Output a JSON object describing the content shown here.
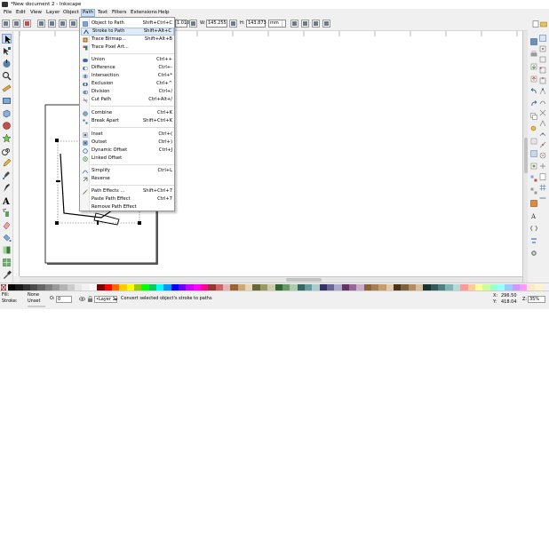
{
  "window": {
    "title": "*New document 2 - Inkscape"
  },
  "menubar": {
    "items": [
      "File",
      "Edit",
      "View",
      "Layer",
      "Object",
      "Path",
      "Text",
      "Filters",
      "Extensions",
      "Help"
    ],
    "active": "Path"
  },
  "controls": {
    "x_value": "1.010",
    "w_label": "W:",
    "w_value": "145.255",
    "h_label": "H:",
    "h_value": "143.873",
    "unit": "mm"
  },
  "path_menu": {
    "items": [
      {
        "label": "Object to Path",
        "shortcut": "Shift+Ctrl+C",
        "icon": "object-to-path-icon"
      },
      {
        "label": "Stroke to Path",
        "shortcut": "Shift+Alt+C",
        "icon": "stroke-to-path-icon",
        "highlighted": true
      },
      {
        "label": "Trace Bitmap...",
        "shortcut": "Shift+Alt+B",
        "icon": "trace-bitmap-icon"
      },
      {
        "label": "Trace Pixel Art...",
        "shortcut": "",
        "icon": "trace-pixel-art-icon"
      },
      {
        "label": "Union",
        "shortcut": "Ctrl++",
        "icon": "union-icon"
      },
      {
        "label": "Difference",
        "shortcut": "Ctrl+-",
        "icon": "difference-icon"
      },
      {
        "label": "Intersection",
        "shortcut": "Ctrl+*",
        "icon": "intersection-icon"
      },
      {
        "label": "Exclusion",
        "shortcut": "Ctrl+^",
        "icon": "exclusion-icon"
      },
      {
        "label": "Division",
        "shortcut": "Ctrl+/",
        "icon": "division-icon"
      },
      {
        "label": "Cut Path",
        "shortcut": "Ctrl+Alt+/",
        "icon": "cut-path-icon"
      },
      {
        "label": "Combine",
        "shortcut": "Ctrl+K",
        "icon": "combine-icon"
      },
      {
        "label": "Break Apart",
        "shortcut": "Shift+Ctrl+K",
        "icon": "break-apart-icon"
      },
      {
        "label": "Inset",
        "shortcut": "Ctrl+(",
        "icon": "inset-icon"
      },
      {
        "label": "Outset",
        "shortcut": "Ctrl+)",
        "icon": "outset-icon"
      },
      {
        "label": "Dynamic Offset",
        "shortcut": "Ctrl+J",
        "icon": "dynamic-offset-icon"
      },
      {
        "label": "Linked Offset",
        "shortcut": "",
        "icon": "linked-offset-icon"
      },
      {
        "label": "Simplify",
        "shortcut": "Ctrl+L",
        "icon": "simplify-icon"
      },
      {
        "label": "Reverse",
        "shortcut": "",
        "icon": "reverse-icon"
      },
      {
        "label": "Path Effects ...",
        "shortcut": "Shift+Ctrl+7",
        "icon": "path-effects-icon"
      },
      {
        "label": "Paste Path Effect",
        "shortcut": "Ctrl+7",
        "icon": ""
      },
      {
        "label": "Remove Path Effect",
        "shortcut": "",
        "icon": ""
      }
    ]
  },
  "status": {
    "fill_label": "Fill:",
    "fill_value": "None",
    "stroke_label": "Stroke:",
    "stroke_value": "Unset",
    "opacity_label": "O:",
    "opacity_value": "0",
    "layer": "•Layer 1",
    "message": "Convert selected object's stroke to paths",
    "x_label": "X:",
    "x_value": "296.50",
    "y_label": "Y:",
    "y_value": "418.04",
    "zoom_label": "Z:",
    "zoom_value": "35%"
  },
  "colors": {
    "menu_highlight": "#dfeaf7",
    "palette": [
      "#000000",
      "#1a1a1a",
      "#333333",
      "#4d4d4d",
      "#666666",
      "#808080",
      "#999999",
      "#b3b3b3",
      "#cccccc",
      "#e6e6e6",
      "#f2f2f2",
      "#ffffff",
      "#800000",
      "#ff0000",
      "#ff6600",
      "#ffcc00",
      "#ffff00",
      "#99cc00",
      "#00ff00",
      "#00cc66",
      "#00ffff",
      "#0099ff",
      "#0000ff",
      "#6600ff",
      "#cc00ff",
      "#ff00ff",
      "#ff0099",
      "#993333",
      "#cc6666",
      "#e6b3b3",
      "#996633",
      "#ccaa77",
      "#e6d5b3",
      "#666633",
      "#999966",
      "#ccccaa",
      "#336633",
      "#669966",
      "#aaccaa",
      "#336666",
      "#669999",
      "#aacccc",
      "#333366",
      "#666699",
      "#aaaacc",
      "#663366",
      "#996699",
      "#ccaacc",
      "#8c6239",
      "#a67c52",
      "#c69c6d",
      "#e6c9a8",
      "#4d3319",
      "#806040",
      "#b38c66",
      "#d9bf99",
      "#1a3333",
      "#335959",
      "#4d8080",
      "#80b3b3",
      "#b3d9d9",
      "#ff9999",
      "#ffcc99",
      "#ffff99",
      "#ccff99",
      "#99ffcc",
      "#99ffff",
      "#99ccff",
      "#cc99ff",
      "#ff99ff",
      "#ffe6cc",
      "#fff2cc"
    ]
  }
}
